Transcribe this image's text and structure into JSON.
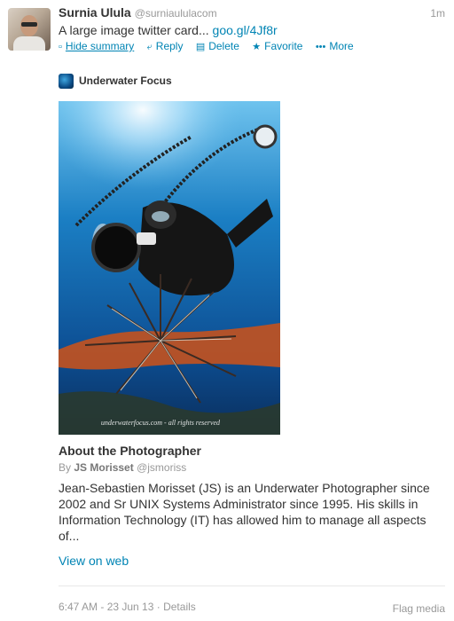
{
  "tweet": {
    "fullname": "Surnia Ulula",
    "username": "@surniaululacom",
    "time": "1m",
    "text": "A large image twitter card...",
    "link": "goo.gl/4Jf8r"
  },
  "actions": {
    "hide_summary": "Hide summary",
    "reply": "Reply",
    "delete": "Delete",
    "favorite": "Favorite",
    "more": "More"
  },
  "icons": {
    "summary": "document-icon",
    "reply": "reply-arrow-icon",
    "delete": "trash-icon",
    "favorite": "star-icon",
    "more": "ellipsis-icon"
  },
  "card": {
    "source_name": "Underwater Focus",
    "photo_watermark": "underwaterfocus.com - all rights reserved",
    "title": "About the Photographer",
    "byline_prefix": "By",
    "author": "JS Morisset",
    "author_handle": "@jsmoriss",
    "description": "Jean-Sebastien Morisset (JS) is an Underwater Photographer since 2002 and Sr UNIX Systems Administrator since 1995. His skills in Information Technology (IT) has allowed him to manage all aspects of...",
    "view_on_web": "View on web"
  },
  "footer": {
    "timestamp": "6:47 AM - 23 Jun 13",
    "separator": "·",
    "details": "Details",
    "flag_media": "Flag media"
  },
  "colors": {
    "link": "#0084b4",
    "text": "#333333",
    "muted": "#999999"
  }
}
